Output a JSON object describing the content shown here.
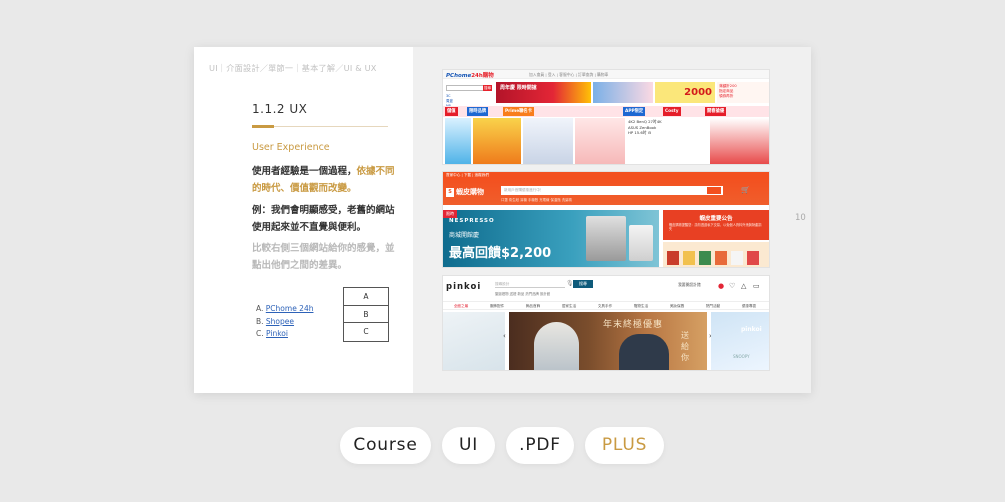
{
  "slide": {
    "breadcrumb": "UI｜介面設計／單節一｜基本了解／UI & UX",
    "section_title": "1.1.2 UX",
    "subtitle": "User Experience",
    "para1_a": "使用者經驗是一個過程，",
    "para1_b": "依據不同的時代、價值觀而改變",
    "para1_c": "。",
    "para2": "例：我們會明顯感受，老舊的網站使用起來並不直覺與便利。",
    "para3": "比較右側三個網站給你的感覺，並點出他們之間的差異。",
    "links": [
      {
        "prefix": "A. ",
        "label": "PChome 24h"
      },
      {
        "prefix": "B. ",
        "label": "Shopee"
      },
      {
        "prefix": "C. ",
        "label": "Pinkoi"
      }
    ],
    "abc": [
      "A",
      "B",
      "C"
    ],
    "page_number": "10"
  },
  "shots": {
    "pchome": {
      "logo_a": "PChome",
      "logo_b": "24h購物",
      "toplinks": "加入會員 | 登入 | 客服中心 | 訂單查詢 | 購物車",
      "search_btn": "搜尋",
      "categories": [
        "3C",
        "周邊",
        "NB",
        "通訊",
        "數位",
        "家電",
        "日用",
        "美妝"
      ],
      "banner_text": "周年慶 限時開搶",
      "banner3_text": "2000",
      "banner4_lines": [
        "滿額折200",
        "指定商品",
        "領券再折"
      ],
      "tags": [
        "儲值",
        "限時品牌",
        "Prime聯名卡",
        "APP限定",
        "Costy",
        "開春搶優"
      ],
      "deal_text": [
        "4K2 BenQ 27吋4K",
        "ASUS ZenBook",
        "HP 15.6吋 i5"
      ]
    },
    "shopee": {
      "top": "賣家中心 | 下載 | 追蹤我們",
      "logo": "蝦皮購物",
      "bag": "S",
      "search_placeholder": "新用戶首購優惠進行中！",
      "search_hint": "口罩 衛生紙 耳機 手機殼 充電線 保溫瓶 洗髮精",
      "cart": "🛒",
      "ad_tag": "限時",
      "ad_brand": "NESPRESSO",
      "ad_line1": "商城開館慶",
      "ad_line2": "最高回饋$2,200",
      "notice_title": "蝦皮重要公告",
      "notice_sub": "蝦皮購物提醒您：請勿透過私下交易，以免個人資料外洩與財產損失"
    },
    "pinkoi": {
      "logo": "pinkoi",
      "search_placeholder": "搜尋設計",
      "search_btn": "搜尋",
      "sub": "聖誕禮物  送禮  新品  熱門品牌  設計館",
      "acts": "我要開設計館",
      "nav": [
        "全館之最",
        "服飾配件",
        "飾品首飾",
        "居家生活",
        "文具手作",
        "寵物生活",
        "美妝保養",
        "熱門活動",
        "優惠專區"
      ],
      "hero_title": "年末終極優惠",
      "hero_side": "送給你",
      "right_brand": "pinkoi",
      "right_sub": "SNOOPY"
    }
  },
  "pills": [
    "Course",
    "UI",
    ".PDF",
    "PLUS"
  ]
}
